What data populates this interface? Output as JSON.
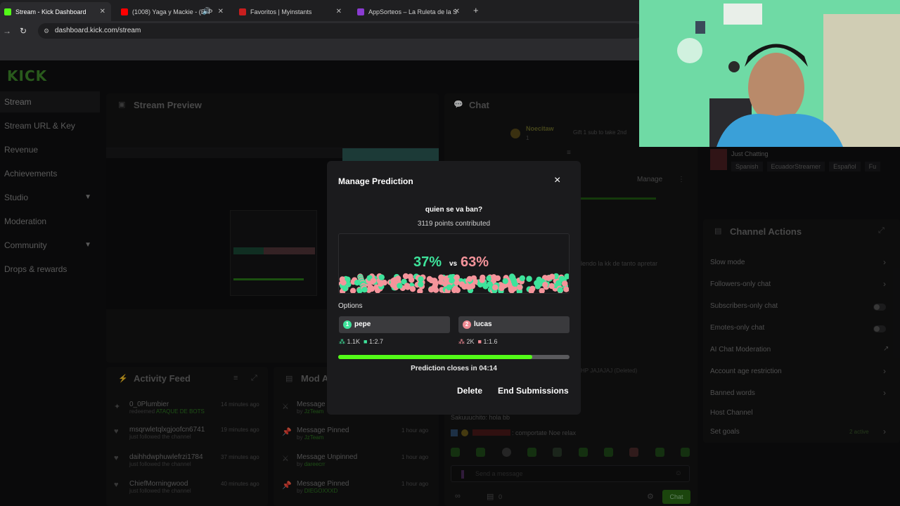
{
  "browser": {
    "tabs": [
      {
        "title": "Stream - Kick Dashboard",
        "color": "#53fc18"
      },
      {
        "title": "(1008) Yaga y Mackie - (El P",
        "color": "#ff0000"
      },
      {
        "title": "Favoritos | Myinstants",
        "color": "#c81e1e"
      },
      {
        "title": "AppSorteos – La Ruleta de la S",
        "color": "#8a3bd1"
      }
    ],
    "new_tab": "+",
    "url": "dashboard.kick.com/stream"
  },
  "logo": "KICK",
  "sidebar": {
    "items": [
      {
        "label": "Stream",
        "active": true
      },
      {
        "label": "Stream URL & Key"
      },
      {
        "label": "Revenue"
      },
      {
        "label": "Achievements"
      },
      {
        "label": "Studio",
        "expandable": true
      },
      {
        "label": "Moderation"
      },
      {
        "label": "Community",
        "expandable": true
      },
      {
        "label": "Drops & rewards"
      }
    ]
  },
  "stream_preview": {
    "title": "Stream Preview"
  },
  "chat": {
    "title": "Chat",
    "pinned_user": "Noecitaw",
    "pinned_count": "1",
    "pinned_text": "Gift 1 sub to take 2nd",
    "manage": "Manage",
    "msg_partial": "lendo la kk de tanto apretar",
    "msg_deleted": "HP JAJAJAJ (Deleted)",
    "msg_1": "Sakuuuchito: hola bb",
    "msg_2": ": comportate Noe relax",
    "input_placeholder": "Send a message",
    "viewer_count": "0",
    "send": "Chat"
  },
  "stream_info": {
    "category": "Just Chatting",
    "tags": [
      "Spanish",
      "EcuadorStreamer",
      "Español",
      "Fu"
    ]
  },
  "activity_feed": {
    "title": "Activity Feed",
    "rows": [
      {
        "user": "0_0Plumbier",
        "action": "redeemed",
        "detail": "ATAQUE DE BOTS",
        "time": "14 minutes ago"
      },
      {
        "user": "msqrwletqlxgjoofcn6741",
        "action": "just followed the channel",
        "detail": "",
        "time": "19 minutes ago"
      },
      {
        "user": "daihhdwphuwlefrzi1784",
        "action": "just followed the channel",
        "detail": "",
        "time": "37 minutes ago"
      },
      {
        "user": "ChiefMorningwood",
        "action": "just followed the channel",
        "detail": "",
        "time": "40 minutes ago"
      }
    ]
  },
  "mod_actions": {
    "title": "Mod A",
    "rows": [
      {
        "action": "Message",
        "by": "JzTeam",
        "time": ""
      },
      {
        "action": "Message Pinned",
        "by": "JzTeam",
        "time": "1 hour ago"
      },
      {
        "action": "Message Unpinned",
        "by": "dareecrr",
        "time": "1 hour ago"
      },
      {
        "action": "Message Pinned",
        "by": "DIEGOXXXD",
        "time": "1 hour ago"
      }
    ],
    "by_prefix": "by"
  },
  "channel_actions": {
    "title": "Channel Actions",
    "items": [
      {
        "label": "Slow mode",
        "control": "arrow"
      },
      {
        "label": "Followers-only chat",
        "control": "arrow"
      },
      {
        "label": "Subscribers-only chat",
        "control": "toggle"
      },
      {
        "label": "Emotes-only chat",
        "control": "toggle"
      },
      {
        "label": "AI Chat Moderation",
        "control": "external"
      },
      {
        "label": "Account age restriction",
        "control": "arrow"
      },
      {
        "label": "Banned words",
        "control": "arrow"
      },
      {
        "label": "Host Channel",
        "control": "none"
      },
      {
        "label": "Set goals",
        "control": "arrow",
        "badge": "2 active"
      }
    ]
  },
  "modal": {
    "title": "Manage Prediction",
    "close": "×",
    "question": "quien se va ban?",
    "points": "3119 points contributed",
    "pct_left": "37%",
    "vs": "vs",
    "pct_right": "63%",
    "options_label": "Options",
    "options": [
      {
        "num": "1",
        "label": "pepe",
        "users": "1.1K",
        "ratio": "1:2.7",
        "color": "#3ee39b"
      },
      {
        "num": "2",
        "label": "lucas",
        "users": "2K",
        "ratio": "1:1.6",
        "color": "#f08a93"
      }
    ],
    "progress": 0.84,
    "closes_text": "Prediction closes in 04:14",
    "delete": "Delete",
    "end": "End Submissions",
    "colors": {
      "left": "#3ee39b",
      "right": "#f5949b",
      "accent": "#53fc18"
    }
  }
}
